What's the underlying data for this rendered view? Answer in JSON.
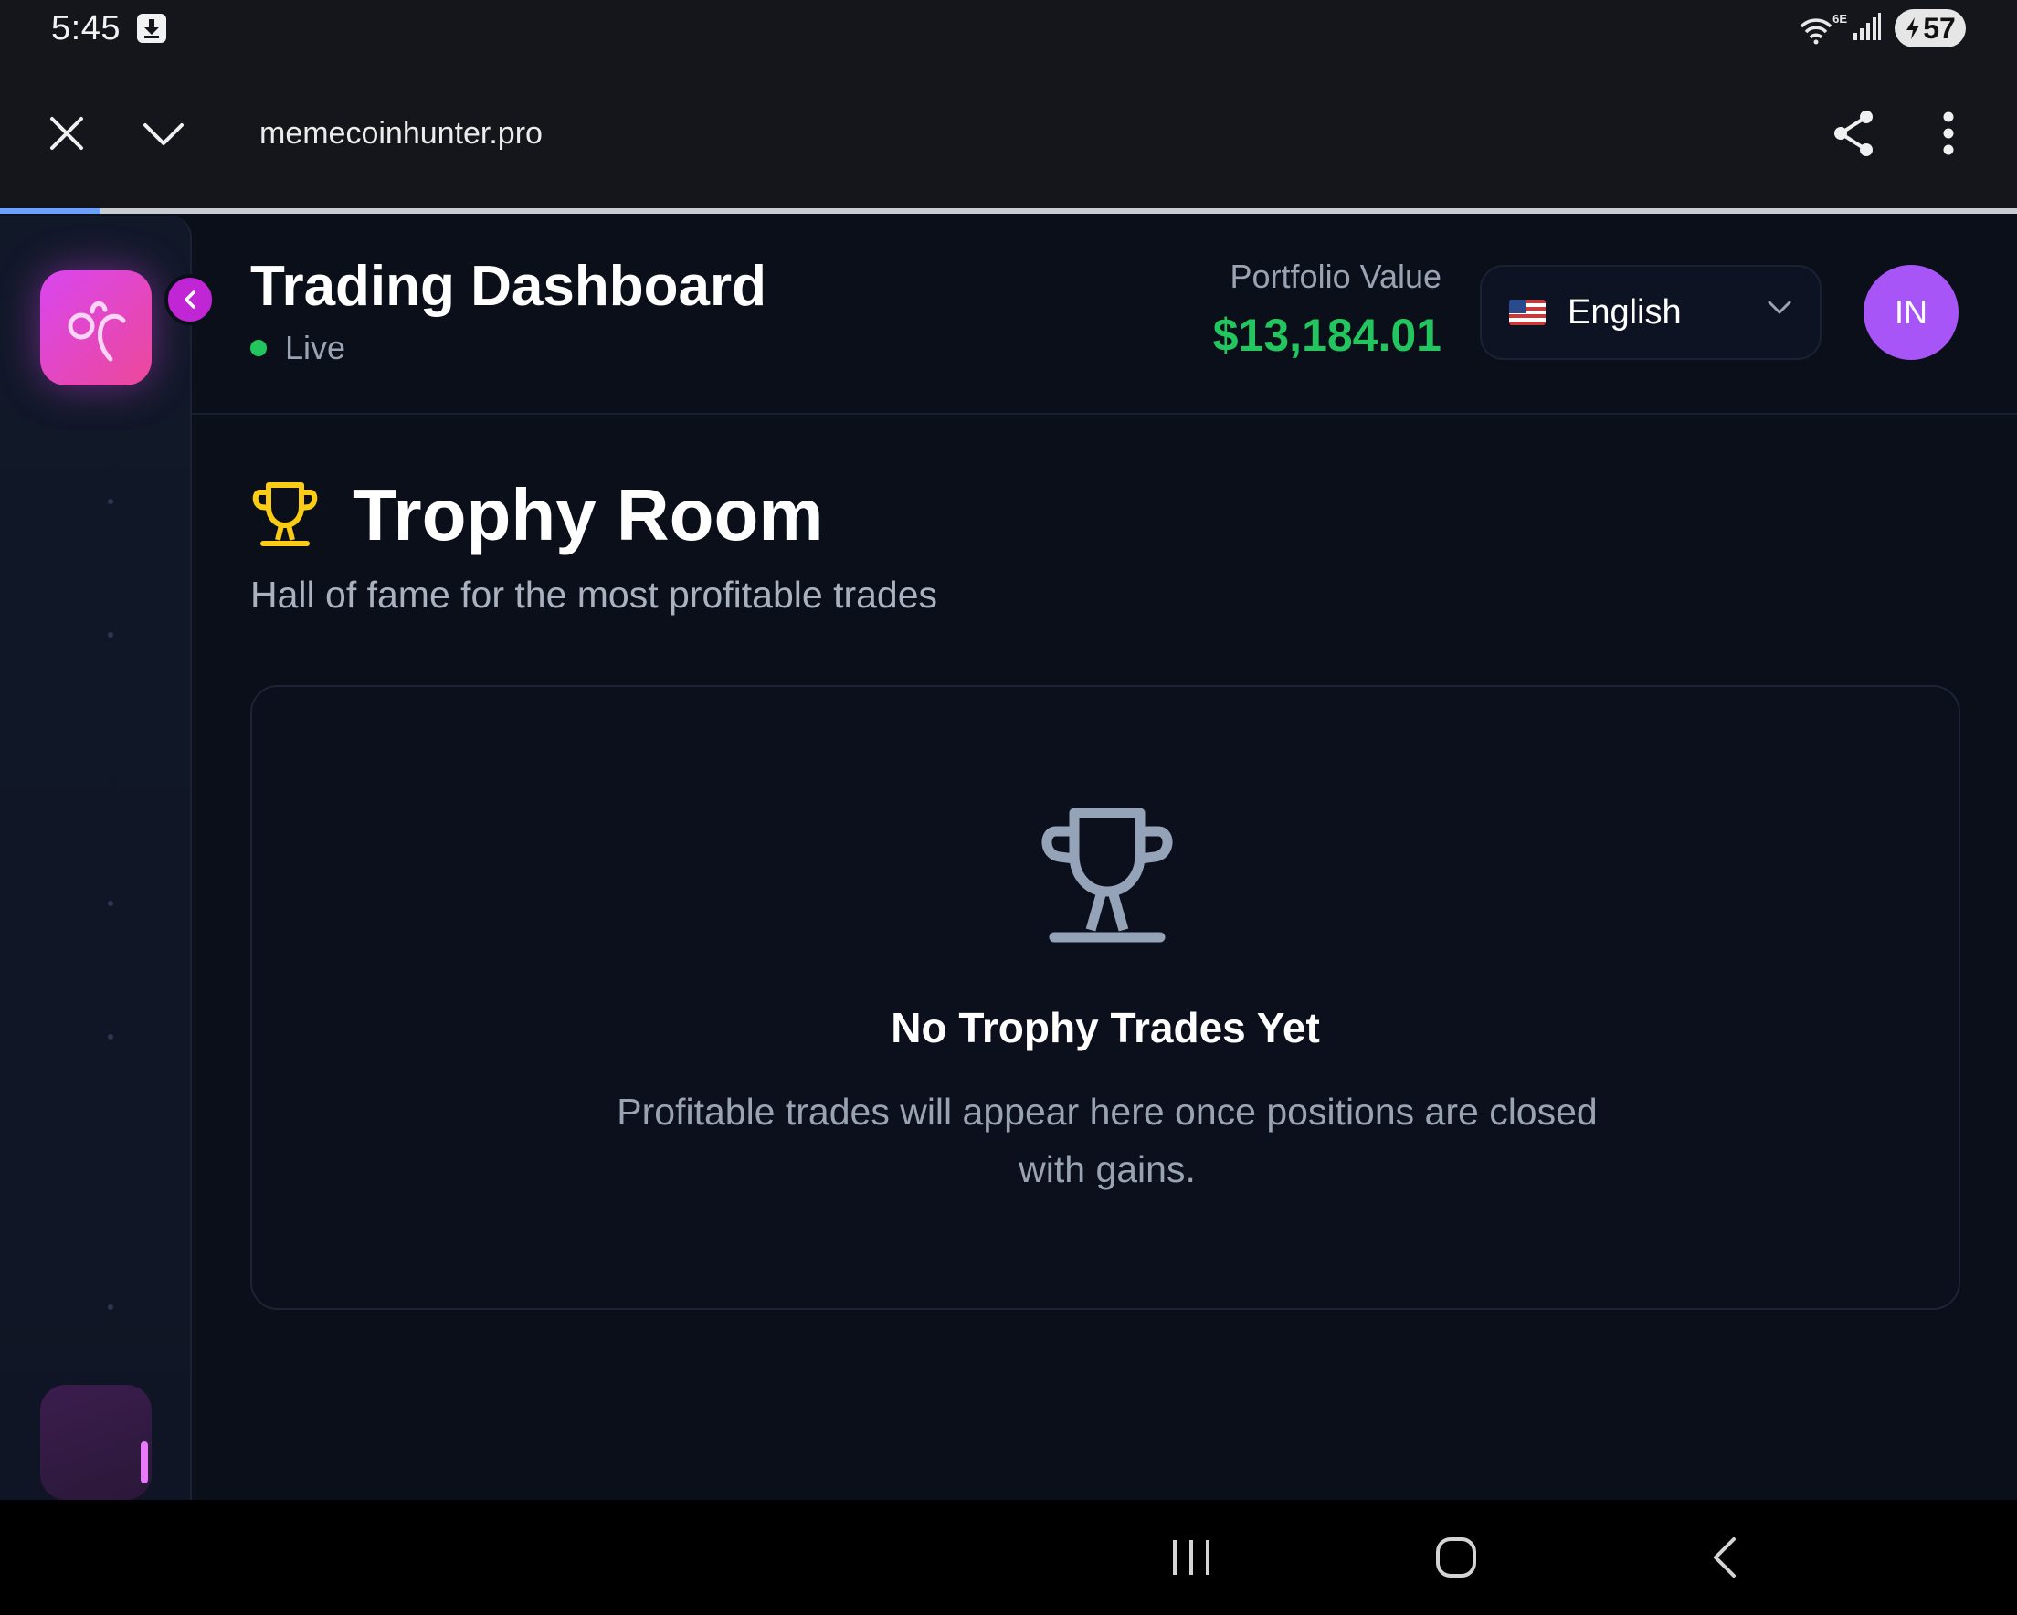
{
  "status_bar": {
    "time": "5:45",
    "network": "6E",
    "battery": "57"
  },
  "browser": {
    "url": "memecoinhunter.pro",
    "load_progress": 0.05
  },
  "header": {
    "title": "Trading Dashboard",
    "status": "Live",
    "portfolio_label": "Portfolio Value",
    "portfolio_value": "$13,184.01",
    "language": "English",
    "avatar_initials": "IN"
  },
  "main": {
    "title": "Trophy Room",
    "subtitle": "Hall of fame for the most profitable trades",
    "empty_title": "No Trophy Trades Yet",
    "empty_description": "Profitable trades will appear here once positions are closed with gains."
  },
  "colors": {
    "background": "#0b0f1a",
    "accent_pink": "#d946ef",
    "positive_green": "#22c55e",
    "avatar_purple": "#a855f7",
    "trophy_gold": "#facc15",
    "muted_text": "#9aa3b2"
  },
  "icons": {
    "download": "download-icon",
    "wifi": "wifi-icon",
    "signal": "signal-icon",
    "battery": "battery-icon",
    "close": "close-icon",
    "collapse": "chevron-down-icon",
    "share": "share-icon",
    "menu": "more-vert-icon",
    "logo": "app-logo-icon",
    "sidebar_toggle": "chevron-left-icon",
    "flag": "us-flag-icon",
    "language_dropdown": "chevron-down-icon",
    "title_trophy": "trophy-icon",
    "empty_trophy": "trophy-icon",
    "recents": "recents-icon",
    "home": "home-icon",
    "back": "back-icon"
  }
}
